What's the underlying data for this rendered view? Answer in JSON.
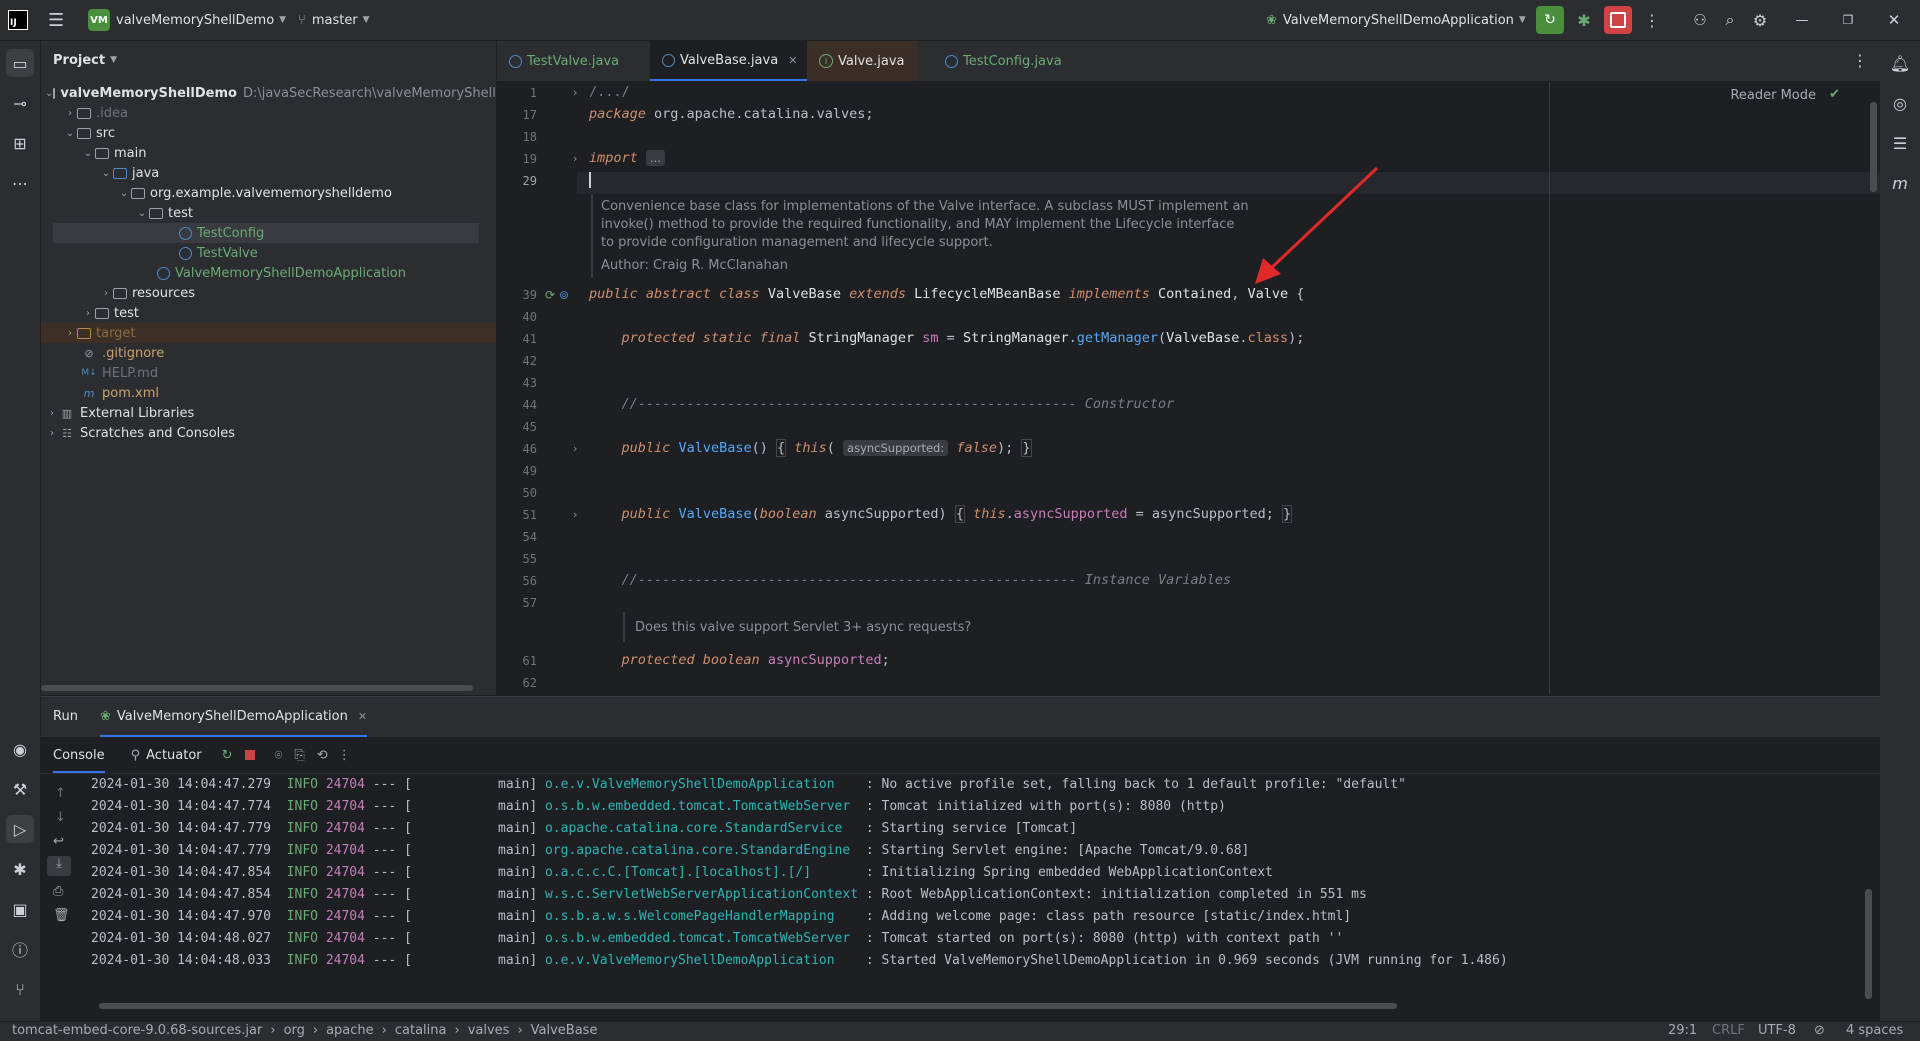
{
  "titlebar": {
    "project_badge": "VM",
    "project_name": "valveMemoryShellDemo",
    "branch": "master",
    "run_config": "ValveMemoryShellDemoApplication"
  },
  "project_panel": {
    "title": "Project",
    "tree": [
      {
        "label": "valveMemoryShellDemo",
        "extra": "D:\\javaSecResearch\\valveMemoryShellDe",
        "kind": "module"
      },
      {
        "label": ".idea",
        "kind": "folder"
      },
      {
        "label": "src",
        "kind": "folder"
      },
      {
        "label": "main",
        "kind": "folder"
      },
      {
        "label": "java",
        "kind": "folder"
      },
      {
        "label": "org.example.valvememoryshelldemo",
        "kind": "package"
      },
      {
        "label": "test",
        "kind": "package"
      },
      {
        "label": "TestConfig",
        "kind": "class"
      },
      {
        "label": "TestValve",
        "kind": "class"
      },
      {
        "label": "ValveMemoryShellDemoApplication",
        "kind": "class"
      },
      {
        "label": "resources",
        "kind": "folder"
      },
      {
        "label": "test",
        "kind": "folder"
      },
      {
        "label": "target",
        "kind": "folder"
      },
      {
        "label": ".gitignore",
        "kind": "file"
      },
      {
        "label": "HELP.md",
        "kind": "file"
      },
      {
        "label": "pom.xml",
        "kind": "file"
      },
      {
        "label": "External Libraries",
        "kind": "lib"
      },
      {
        "label": "Scratches and Consoles",
        "kind": "lib"
      }
    ]
  },
  "editor": {
    "tabs": [
      "TestValve.java",
      "ValveBase.java",
      "Valve.java",
      "TestConfig.java"
    ],
    "active_tab": "ValveBase.java",
    "reader_mode": "Reader Mode",
    "line_numbers": [
      "1",
      "17",
      "18",
      "19",
      "29",
      "39",
      "40",
      "41",
      "42",
      "43",
      "44",
      "45",
      "46",
      "49",
      "50",
      "51",
      "54",
      "55",
      "56",
      "57",
      "61",
      "62"
    ],
    "doc1": [
      "Convenience base class for implementations of the Valve interface. A subclass MUST implement an",
      "invoke() method to provide the required functionality, and MAY implement the Lifecycle interface",
      "to provide configuration management and lifecycle support.",
      "Author: Craig R. McClanahan"
    ],
    "doc2": "Does this valve support Servlet 3+ async requests?",
    "hint_label": "asyncSupported:"
  },
  "run": {
    "tab_run": "Run",
    "tab_app": "ValveMemoryShellDemoApplication",
    "console": "Console",
    "actuator": "Actuator",
    "logs": [
      {
        "ts": "2024-01-30 14:04:47.279",
        "lvl": "INFO",
        "pid": "24704",
        "thr": "--- [           main]",
        "cls": "o.e.v.ValveMemoryShellDemoApplication   ",
        "msg": ": No active profile set, falling back to 1 default profile: \"default\""
      },
      {
        "ts": "2024-01-30 14:04:47.774",
        "lvl": "INFO",
        "pid": "24704",
        "thr": "--- [           main]",
        "cls": "o.s.b.w.embedded.tomcat.TomcatWebServer ",
        "msg": ": Tomcat initialized with port(s): 8080 (http)"
      },
      {
        "ts": "2024-01-30 14:04:47.779",
        "lvl": "INFO",
        "pid": "24704",
        "thr": "--- [           main]",
        "cls": "o.apache.catalina.core.StandardService  ",
        "msg": ": Starting service [Tomcat]"
      },
      {
        "ts": "2024-01-30 14:04:47.779",
        "lvl": "INFO",
        "pid": "24704",
        "thr": "--- [           main]",
        "cls": "org.apache.catalina.core.StandardEngine ",
        "msg": ": Starting Servlet engine: [Apache Tomcat/9.0.68]"
      },
      {
        "ts": "2024-01-30 14:04:47.854",
        "lvl": "INFO",
        "pid": "24704",
        "thr": "--- [           main]",
        "cls": "o.a.c.c.C.[Tomcat].[localhost].[/]      ",
        "msg": ": Initializing Spring embedded WebApplicationContext"
      },
      {
        "ts": "2024-01-30 14:04:47.854",
        "lvl": "INFO",
        "pid": "24704",
        "thr": "--- [           main]",
        "cls": "w.s.c.ServletWebServerApplicationContext",
        "msg": ": Root WebApplicationContext: initialization completed in 551 ms"
      },
      {
        "ts": "2024-01-30 14:04:47.970",
        "lvl": "INFO",
        "pid": "24704",
        "thr": "--- [           main]",
        "cls": "o.s.b.a.w.s.WelcomePageHandlerMapping   ",
        "msg": ": Adding welcome page: class path resource [static/index.html]"
      },
      {
        "ts": "2024-01-30 14:04:48.027",
        "lvl": "INFO",
        "pid": "24704",
        "thr": "--- [           main]",
        "cls": "o.s.b.w.embedded.tomcat.TomcatWebServer ",
        "msg": ": Tomcat started on port(s): 8080 (http) with context path ''"
      },
      {
        "ts": "2024-01-30 14:04:48.033",
        "lvl": "INFO",
        "pid": "24704",
        "thr": "--- [           main]",
        "cls": "o.e.v.ValveMemoryShellDemoApplication   ",
        "msg": ": Started ValveMemoryShellDemoApplication in 0.969 seconds (JVM running for 1.486)"
      }
    ]
  },
  "statusbar": {
    "crumbs": [
      "tomcat-embed-core-9.0.68-sources.jar",
      "org",
      "apache",
      "catalina",
      "valves",
      "ValveBase"
    ],
    "position": "29:1",
    "line_sep": "CRLF",
    "encoding": "UTF-8",
    "indent": "4 spaces"
  },
  "colors": {
    "accent": "#3574f0",
    "run_green": "#4a8f3b",
    "stop_red": "#d04344",
    "annotation_arrow": "#e02a2a"
  }
}
